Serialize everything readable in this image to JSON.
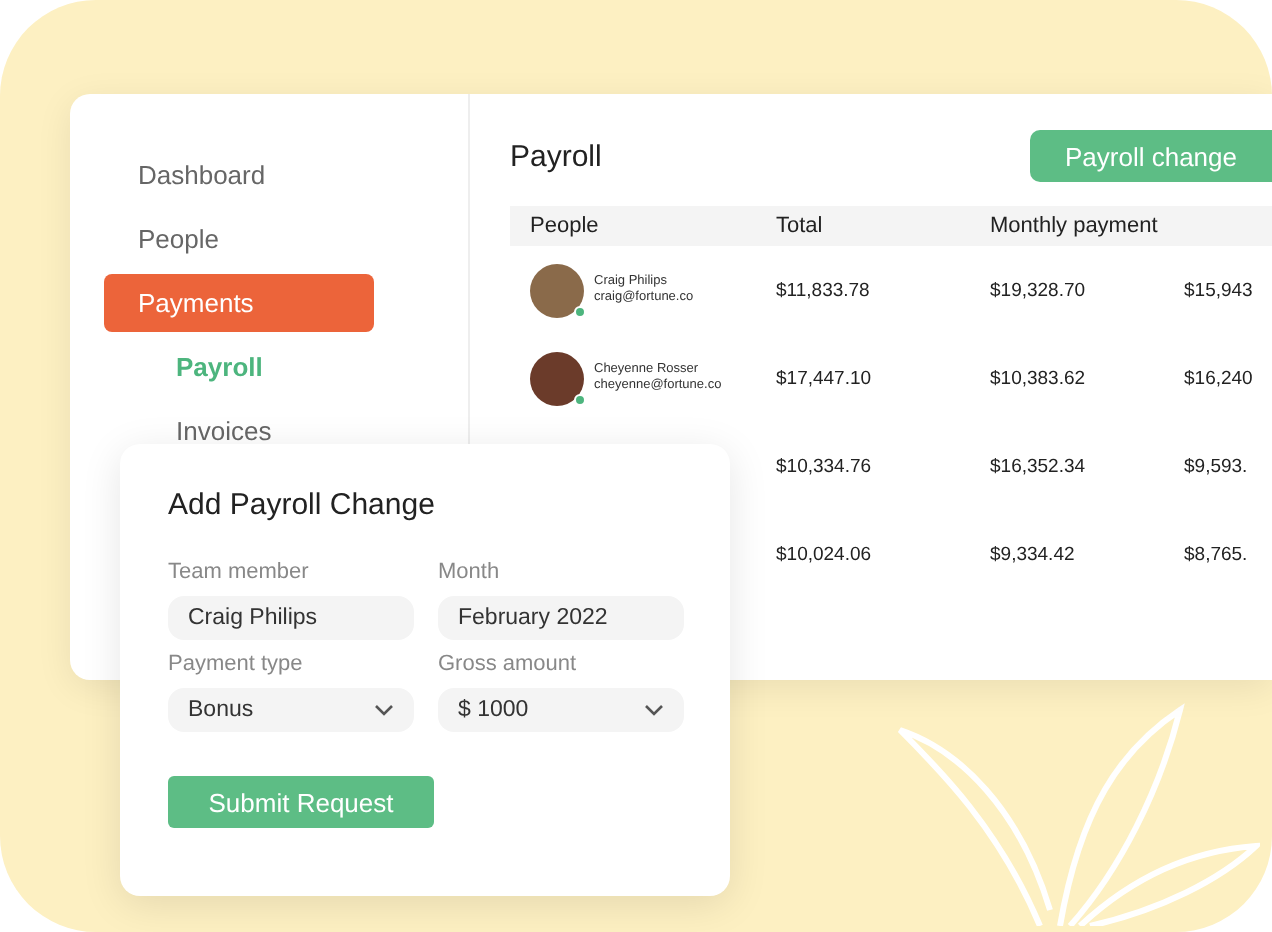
{
  "sidebar": {
    "items": [
      {
        "label": "Dashboard",
        "selected": false
      },
      {
        "label": "People",
        "selected": false
      },
      {
        "label": "Payments",
        "selected": true,
        "children": [
          {
            "label": "Payroll",
            "selected": true
          },
          {
            "label": "Invoices",
            "selected": false
          }
        ]
      }
    ]
  },
  "payroll": {
    "title": "Payroll",
    "action_button": "Payroll change",
    "table": {
      "columns": [
        "People",
        "Total",
        "Monthly payment"
      ],
      "rows": [
        {
          "people": {
            "name": "Craig Philips",
            "email": "craig@fortune.co"
          },
          "total": "$11,833.78",
          "monthly_payment": "$19,328.70",
          "column_4": "$15,943"
        },
        {
          "people": {
            "name": "Cheyenne Rosser",
            "email": "cheyenne@fortune.co"
          },
          "total": "$17,447.10",
          "monthly_payment": "$10,383.62",
          "column_4": "$16,240"
        },
        {
          "total": "$10,334.76",
          "monthly_payment": "$16,352.34",
          "column_4": "$9,593."
        },
        {
          "total": "$10,024.06",
          "monthly_payment": "$9,334.42",
          "column_4": "$8,765."
        }
      ]
    }
  },
  "form": {
    "title": "Add Payroll Change",
    "fields": [
      {
        "label": "Team member",
        "value": "Craig Philips",
        "kind": "text"
      },
      {
        "label": "Month",
        "value": "February 2022",
        "kind": "text"
      },
      {
        "label": "Payment type",
        "value": "Bonus",
        "kind": "select"
      },
      {
        "label": "Gross amount",
        "value": "$ 1000",
        "kind": "select"
      }
    ],
    "submit": "Submit Request"
  }
}
